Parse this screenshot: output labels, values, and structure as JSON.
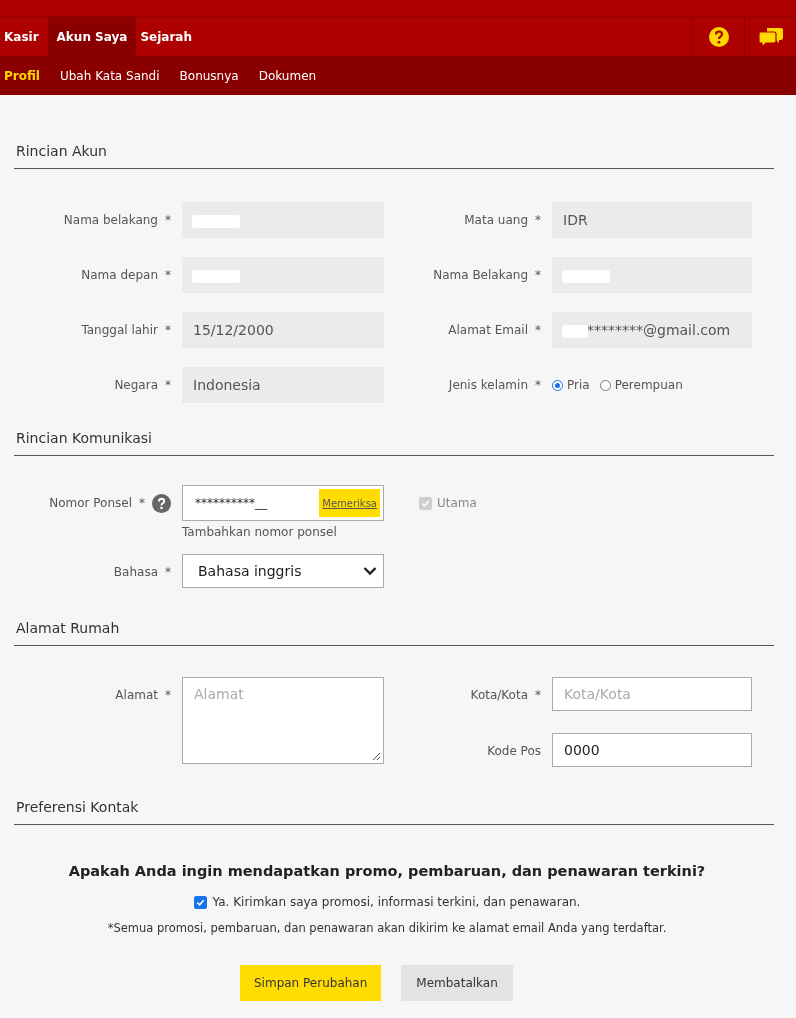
{
  "nav": {
    "tabs": [
      {
        "label": "Kasir",
        "selected": false
      },
      {
        "label": "Akun Saya",
        "selected": true
      },
      {
        "label": "Sejarah",
        "selected": false
      }
    ],
    "subtabs": [
      {
        "label": "Profil",
        "selected": true
      },
      {
        "label": "Ubah Kata Sandi",
        "selected": false
      },
      {
        "label": "Bonusnya",
        "selected": false
      },
      {
        "label": "Dokumen",
        "selected": false
      }
    ]
  },
  "account": {
    "title": "Rincian Akun",
    "rows": [
      [
        {
          "kind": "text",
          "label": "Nama belakang",
          "asterisk": "*",
          "redacted": true
        },
        {
          "kind": "text",
          "label": "Mata uang",
          "asterisk": "*",
          "value": "IDR"
        }
      ],
      [
        {
          "kind": "text",
          "label": "Nama depan",
          "asterisk": "*",
          "redacted": true
        },
        {
          "kind": "text",
          "label": "Nama Belakang",
          "asterisk": "*",
          "redacted": true
        }
      ],
      [
        {
          "kind": "text",
          "label": "Tanggal lahir",
          "asterisk": "*",
          "value": "15/12/2000"
        },
        {
          "kind": "text",
          "label": "Alamat Email",
          "asterisk": "*",
          "value": "********@gmail.com",
          "redacted": true
        }
      ],
      [
        {
          "kind": "text",
          "label": "Negara",
          "asterisk": "*",
          "value": "Indonesia"
        },
        {
          "kind": "radio",
          "label": "Jenis kelamin",
          "asterisk": "*",
          "options": [
            {
              "label": "Pria",
              "selected": true
            },
            {
              "label": "Perempuan",
              "selected": false
            }
          ]
        }
      ]
    ]
  },
  "communication": {
    "title": "Rincian Komunikasi",
    "phone": {
      "label": "Nomor Ponsel",
      "asterisk": "*",
      "value": "**********__",
      "action": "Memeriksa",
      "hint": "Tambahkan nomor ponsel",
      "primary": {
        "label": "Utama",
        "checked": true,
        "disabled": true
      }
    },
    "language": {
      "label": "Bahasa",
      "asterisk": "*",
      "value": "Bahasa inggris"
    }
  },
  "address": {
    "title": "Alamat Rumah",
    "street": {
      "label": "Alamat",
      "asterisk": "*",
      "placeholder": "Alamat"
    },
    "city": {
      "label": "Kota/Kota",
      "asterisk": "*",
      "placeholder": "Kota/Kota"
    },
    "postcode": {
      "label": "Kode Pos",
      "value": "0000"
    }
  },
  "contact": {
    "title": "Preferensi Kontak",
    "question": "Apakah Anda ingin mendapatkan promo, pembaruan, dan penawaran terkini?",
    "consent": {
      "label": "Ya. Kirimkan saya promosi, informasi terkini, dan penawaran.",
      "checked": true
    },
    "note": "*Semua promosi, pembaruan, dan penawaran akan dikirim ke alamat email Anda yang terdaftar."
  },
  "buttons": [
    {
      "kind": "primary",
      "label": "Simpan Perubahan"
    },
    {
      "kind": "secondary",
      "label": "Membatalkan"
    }
  ]
}
